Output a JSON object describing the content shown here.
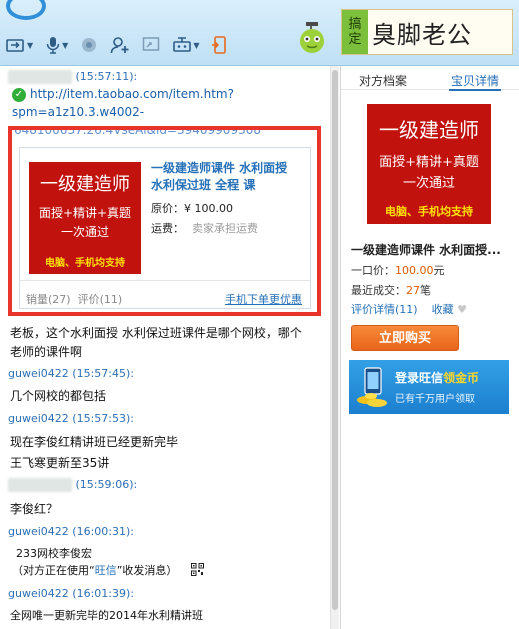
{
  "header": {
    "toolbar": [
      {
        "name": "transfer-file-button",
        "icon": "folder-transfer-icon"
      },
      {
        "name": "voice-button",
        "icon": "microphone-icon"
      },
      {
        "name": "video-button",
        "icon": "camera-icon"
      },
      {
        "name": "add-contact-button",
        "icon": "add-user-icon"
      },
      {
        "name": "remote-assist-button",
        "icon": "remote-screen-icon"
      },
      {
        "name": "app-store-button",
        "icon": "robot-app-icon"
      },
      {
        "name": "mobile-button",
        "icon": "mobile-phone-icon"
      }
    ],
    "ad": {
      "seal": [
        "搞",
        "定"
      ],
      "text": "臭脚老公"
    }
  },
  "chat": {
    "messages": [
      {
        "sender": "",
        "time": "(15:57:11):"
      },
      {
        "url_line1": "http://item.taobao.com/item.htm?",
        "url_line2": "spm=a1z10.3.w4002-",
        "url_cut": "648100637.26.4VseAl&id=39409909308"
      },
      {
        "card": {
          "promo_l1": "一级建造师",
          "promo_l2": "面授+精讲+真题",
          "promo_l3": "一次通过",
          "promo_l4": "电脑、手机均支持",
          "title": "一级建造师课件 水利面授 水利保过班 全程 课",
          "price_label": "原价：",
          "price": "¥ 100.00",
          "ship_label": "运费：",
          "ship_value": "卖家承担运费",
          "sales": "销量(27)",
          "reviews": "评价(11)",
          "mobile_link": "手机下单更优惠"
        }
      },
      {
        "text_l1": "老板，这个水利面授 水利保过班课件是哪个网校，哪个",
        "text_l2": "老师的课件啊"
      },
      {
        "sender": "guwei0422",
        "time": "(15:57:45):",
        "text": "几个网校的都包括"
      },
      {
        "sender": "guwei0422",
        "time": "(15:57:53):",
        "text_l1": "现在李俊红精讲班已经更新完毕",
        "text_l2": "王飞寒更新至35讲"
      },
      {
        "sender": "",
        "time": "(15:59:06):",
        "text": "李俊红？"
      },
      {
        "sender": "guwei0422",
        "time": "(16:00:31):",
        "text_l1": "233网校李俊宏",
        "text_l2_pre": "（对方正在使用“",
        "text_l2_link": "旺信",
        "text_l2_post": "”收发消息）"
      },
      {
        "sender": "guwei0422",
        "time": "(16:01:39):",
        "text": "全网唯一更新完毕的2014年水利精讲班"
      }
    ]
  },
  "right": {
    "tab1": "对方档案",
    "tab2": "宝贝详情",
    "title": "一级建造师课件 水利面授...",
    "price_label": "一口价：",
    "price": "100.00",
    "price_unit": "元",
    "recent_label": "最近成交：",
    "recent_count": "27",
    "recent_unit": "笔",
    "reviews_link": "评价详情(11)",
    "favorite": "收藏",
    "buy_button": "立即购买",
    "banner_l1_pre": "登录旺信",
    "banner_l1_gold": "领金币",
    "banner_l2": "已有千万用户领取"
  },
  "colors": {
    "accent": "#2670b8",
    "promo_red": "#c2120e",
    "frame_red": "#e8342b",
    "buy_orange": "#e8641a"
  }
}
